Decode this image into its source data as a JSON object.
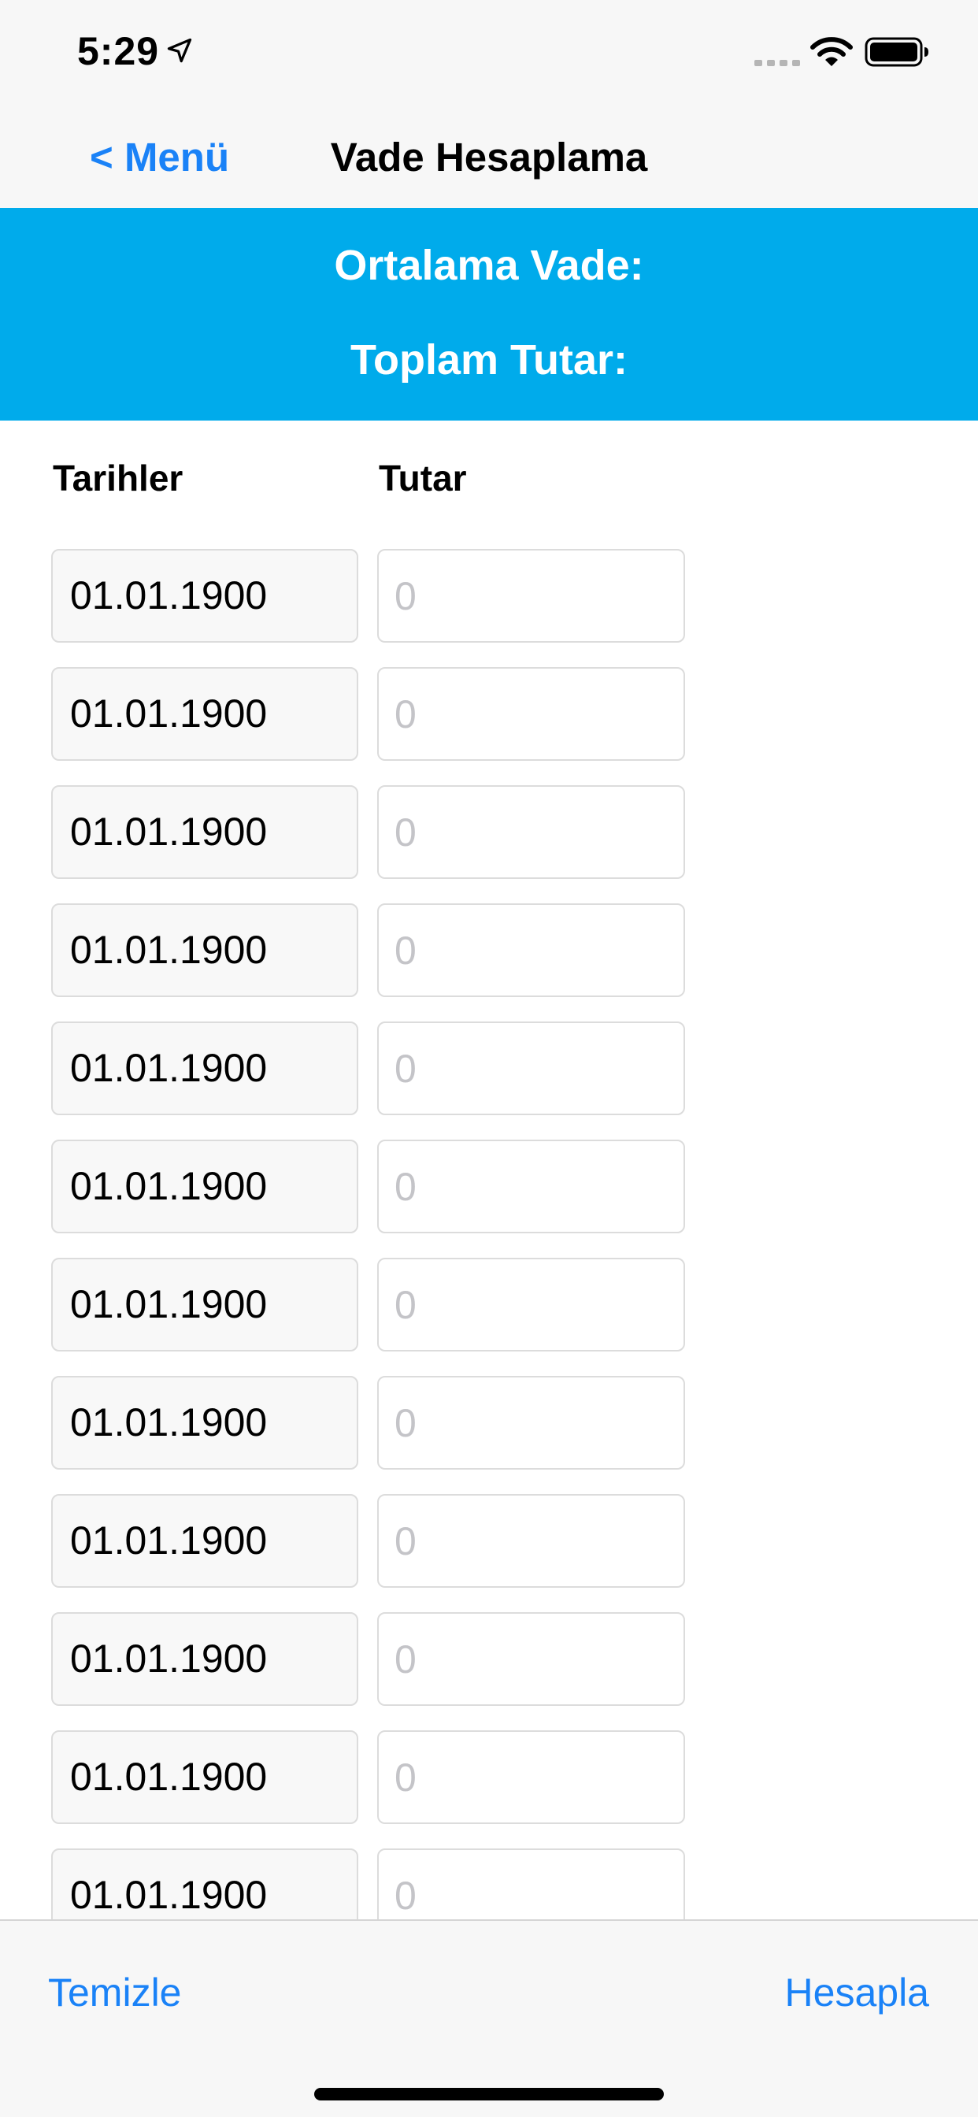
{
  "status_bar": {
    "time": "5:29",
    "icons": [
      "location-arrow-icon",
      "cellular-signal-icon",
      "wifi-icon",
      "battery-icon"
    ]
  },
  "nav": {
    "back_label": "< Menü",
    "title": "Vade Hesaplama"
  },
  "summary": {
    "average_label": "Ortalama Vade:",
    "total_label": "Toplam Tutar:",
    "background_color": "#00abeb"
  },
  "columns": {
    "dates": "Tarihler",
    "amount": "Tutar"
  },
  "rows": [
    {
      "date": "01.01.1900",
      "amount_placeholder": "0"
    },
    {
      "date": "01.01.1900",
      "amount_placeholder": "0"
    },
    {
      "date": "01.01.1900",
      "amount_placeholder": "0"
    },
    {
      "date": "01.01.1900",
      "amount_placeholder": "0"
    },
    {
      "date": "01.01.1900",
      "amount_placeholder": "0"
    },
    {
      "date": "01.01.1900",
      "amount_placeholder": "0"
    },
    {
      "date": "01.01.1900",
      "amount_placeholder": "0"
    },
    {
      "date": "01.01.1900",
      "amount_placeholder": "0"
    },
    {
      "date": "01.01.1900",
      "amount_placeholder": "0"
    },
    {
      "date": "01.01.1900",
      "amount_placeholder": "0"
    },
    {
      "date": "01.01.1900",
      "amount_placeholder": "0"
    },
    {
      "date": "01.01.1900",
      "amount_placeholder": "0"
    }
  ],
  "toolbar": {
    "clear_label": "Temizle",
    "calculate_label": "Hesapla"
  },
  "colors": {
    "accent": "#1a82f7",
    "bar_background": "#f7f7f7"
  }
}
